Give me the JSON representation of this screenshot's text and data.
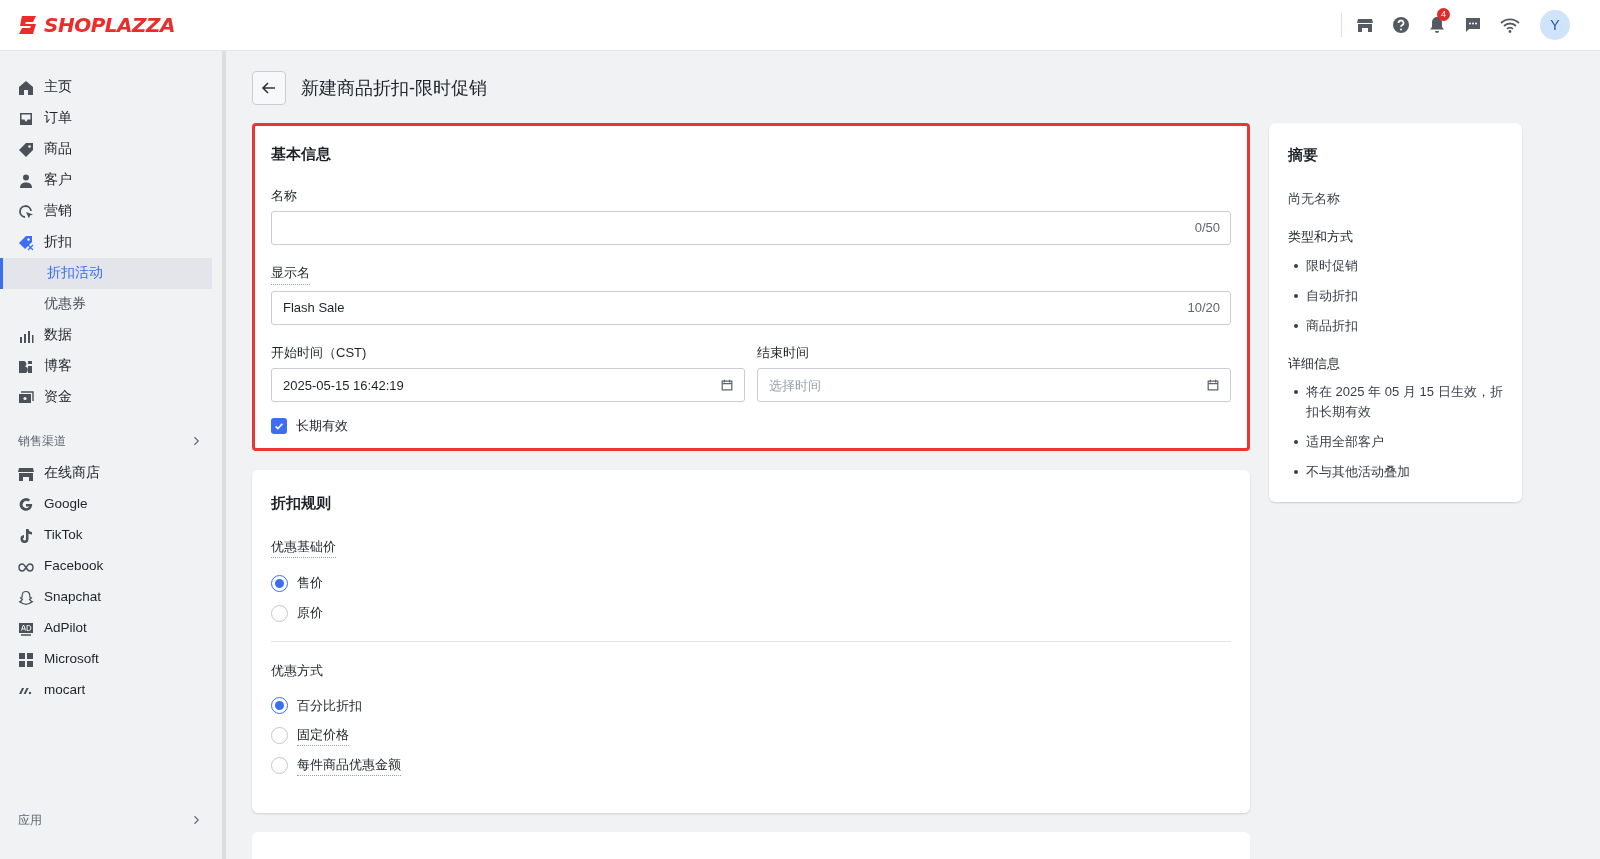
{
  "brand": {
    "name": "SHOPLAZZA"
  },
  "topbar": {
    "notification_count": "4",
    "avatar": "Y"
  },
  "sidebar": {
    "items": [
      {
        "label": "主页",
        "selected": false
      },
      {
        "label": "订单",
        "selected": false
      },
      {
        "label": "商品",
        "selected": false
      },
      {
        "label": "客户",
        "selected": false
      },
      {
        "label": "营销",
        "selected": false
      },
      {
        "label": "折扣",
        "selected": false,
        "children": [
          {
            "label": "折扣活动",
            "selected": true
          },
          {
            "label": "优惠券",
            "selected": false
          }
        ]
      },
      {
        "label": "数据",
        "selected": false
      },
      {
        "label": "博客",
        "selected": false
      },
      {
        "label": "资金",
        "selected": false
      }
    ],
    "channels_header": "销售渠道",
    "channels": [
      {
        "label": "在线商店",
        "selected": false
      },
      {
        "label": "Google",
        "selected": false
      },
      {
        "label": "TikTok",
        "selected": false
      },
      {
        "label": "Facebook",
        "selected": false
      },
      {
        "label": "Snapchat",
        "selected": false
      },
      {
        "label": "AdPilot",
        "selected": false
      },
      {
        "label": "Microsoft",
        "selected": false
      },
      {
        "label": "mocart",
        "selected": false
      }
    ],
    "apps_header": "应用"
  },
  "page": {
    "title": "新建商品折扣-限时促销"
  },
  "basic_info": {
    "title": "基本信息",
    "name": {
      "label": "名称",
      "dotted": false,
      "counter": "0/50"
    },
    "display_name": {
      "label": "显示名",
      "dotted": true,
      "value": "Flash Sale",
      "counter": "10/20"
    },
    "start_time": {
      "label": "开始时间（CST)",
      "value": "2025-05-15 16:42:19"
    },
    "end_time": {
      "label": "结束时间",
      "placeholder": "选择时间"
    },
    "long_term": {
      "label": "长期有效",
      "checked": true
    }
  },
  "rules": {
    "title": "折扣规则",
    "groups": [
      {
        "label": "优惠基础价",
        "dotted": true,
        "options": [
          {
            "label": "售价",
            "selected": true,
            "dotted": false
          },
          {
            "label": "原价",
            "selected": false,
            "dotted": false
          }
        ]
      },
      {
        "label": "优惠方式",
        "dotted": false,
        "options": [
          {
            "label": "百分比折扣",
            "selected": true,
            "dotted": false
          },
          {
            "label": "固定价格",
            "selected": false,
            "dotted": true
          },
          {
            "label": "每件商品优惠金额",
            "selected": false,
            "dotted": true
          }
        ]
      }
    ]
  },
  "summary": {
    "title": "摘要",
    "name": "尚无名称",
    "sections": [
      {
        "title": "类型和方式",
        "items": [
          "限时促销",
          "自动折扣",
          "商品折扣"
        ]
      },
      {
        "title": "详细信息",
        "items": [
          "将在 2025 年 05 月 15 日生效，折扣长期有效",
          "适用全部客户",
          "不与其他活动叠加"
        ]
      }
    ]
  }
}
